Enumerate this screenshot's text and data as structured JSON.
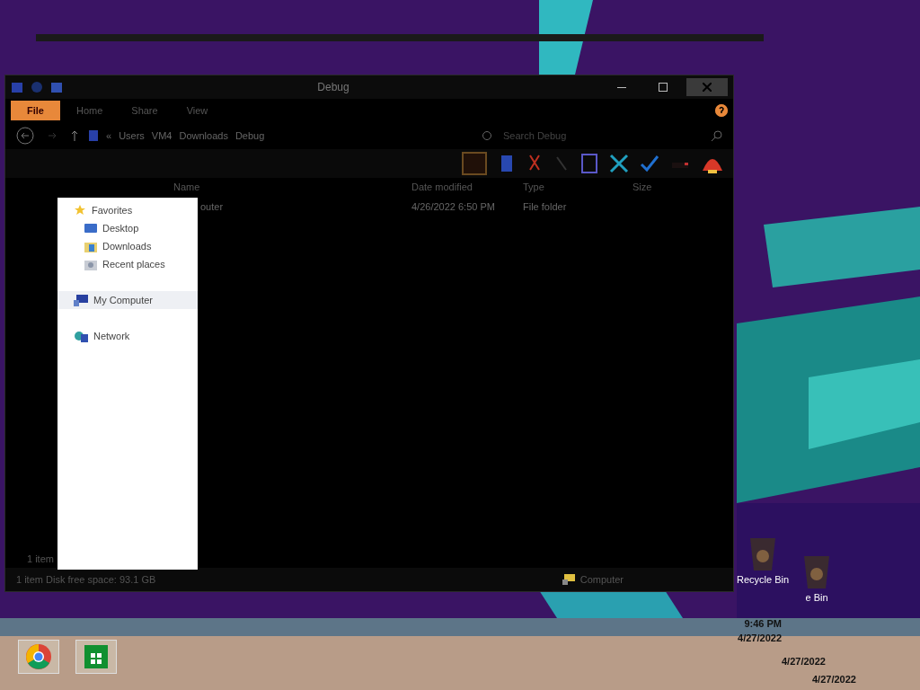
{
  "window": {
    "title": "Debug"
  },
  "ribbon_tabs": [
    {
      "label": "File",
      "selected": true
    },
    {
      "label": "Home",
      "selected": false
    },
    {
      "label": "Share",
      "selected": false
    },
    {
      "label": "View",
      "selected": false
    }
  ],
  "address": {
    "crumbs": [
      "«",
      "Users",
      "VM4",
      "Downloads",
      "Debug"
    ]
  },
  "search": {
    "placeholder": "Search Debug"
  },
  "table": {
    "columns": [
      "Name",
      "Date modified",
      "Type",
      "Size"
    ],
    "rows": [
      {
        "name": "outer",
        "date": "4/26/2022 6:50 PM",
        "type": "File folder"
      }
    ]
  },
  "nav_popup": {
    "items": [
      {
        "label": "Favorites",
        "kind": "favorites",
        "selected": false,
        "children": [
          {
            "label": "Desktop",
            "kind": "desktop",
            "selected": false
          },
          {
            "label": "Downloads",
            "kind": "downloads",
            "selected": false
          },
          {
            "label": "Recent places",
            "kind": "recent",
            "selected": false
          }
        ]
      },
      {
        "label": "My Computer",
        "kind": "computer",
        "selected": true
      },
      {
        "label": "Network",
        "kind": "network",
        "selected": false
      }
    ]
  },
  "item_count": "1 item",
  "status_bar": {
    "left": "1 item  Disk free space: 93.1 GB",
    "right": "Computer"
  },
  "desktop": {
    "icons": [
      {
        "label": "Recycle Bin"
      },
      {
        "label": "e Bin"
      }
    ]
  },
  "taskbar": {
    "apps": [
      {
        "kind": "chrome"
      },
      {
        "kind": "store"
      }
    ],
    "time": "9:46 PM",
    "date": "4/27/2022",
    "ghost_dates": [
      "4/27/2022",
      "4/27/2022"
    ]
  }
}
